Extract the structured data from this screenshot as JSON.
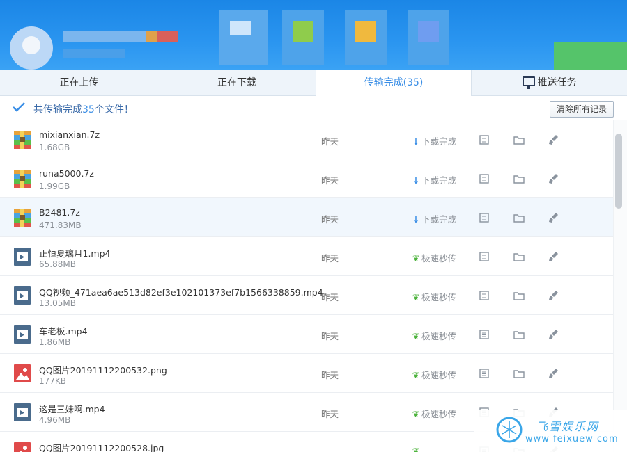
{
  "tabs": {
    "uploading": "正在上传",
    "downloading": "正在下载",
    "completed": "传输完成(35)",
    "push": "推送任务"
  },
  "summary": {
    "prefix": "共传输完成",
    "count": "35",
    "suffix": "个文件！",
    "clear_button": "清除所有记录"
  },
  "files": [
    {
      "name": "mixianxian.7z",
      "size": "1.68GB",
      "time": "昨天",
      "status": "下载完成",
      "status_type": "download",
      "icon": "archive-file-icon"
    },
    {
      "name": "runa5000.7z",
      "size": "1.99GB",
      "time": "昨天",
      "status": "下载完成",
      "status_type": "download",
      "icon": "archive-file-icon"
    },
    {
      "name": "B2481.7z",
      "size": "471.83MB",
      "time": "昨天",
      "status": "下载完成",
      "status_type": "download",
      "icon": "archive-file-icon"
    },
    {
      "name": "正恒夏璃月1.mp4",
      "size": "65.88MB",
      "time": "昨天",
      "status": "极速秒传",
      "status_type": "fast",
      "icon": "video-file-icon"
    },
    {
      "name": "QQ视频_471aea6ae513d82ef3e102101373ef7b1566338859.mp4",
      "size": "13.05MB",
      "time": "昨天",
      "status": "极速秒传",
      "status_type": "fast",
      "icon": "video-file-icon"
    },
    {
      "name": "车老板.mp4",
      "size": "1.86MB",
      "time": "昨天",
      "status": "极速秒传",
      "status_type": "fast",
      "icon": "video-file-icon"
    },
    {
      "name": "QQ图片20191112200532.png",
      "size": "177KB",
      "time": "昨天",
      "status": "极速秒传",
      "status_type": "fast",
      "icon": "image-file-icon"
    },
    {
      "name": "这是三妹啊.mp4",
      "size": "4.96MB",
      "time": "昨天",
      "status": "极速秒传",
      "status_type": "fast",
      "icon": "video-file-icon"
    },
    {
      "name": "QQ图片20191112200528.jpg",
      "size": "",
      "time": "",
      "status": "",
      "status_type": "fast",
      "icon": "image-file-icon"
    }
  ],
  "watermark": {
    "title": "飞雪娱乐网",
    "url": "www feixuew com"
  },
  "colors": {
    "accent": "#3a8ee6",
    "header_blue": "#2a95f0",
    "fast_green": "#4db33d"
  }
}
